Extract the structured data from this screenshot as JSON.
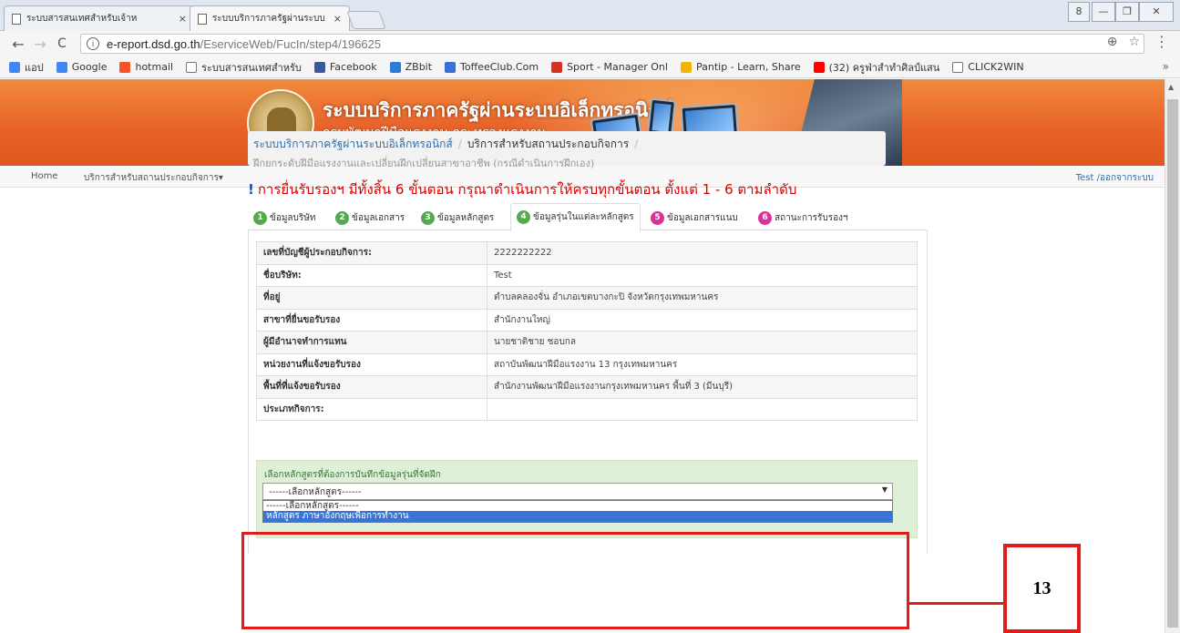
{
  "browser": {
    "tabs": [
      {
        "title": "ระบบสารสนเทศสำหรับเจ้าห",
        "close": "×"
      },
      {
        "title": "ระบบบริการภาครัฐผ่านระบบ",
        "close": "×"
      }
    ],
    "window_controls": [
      "8",
      "—",
      "❐",
      "✕"
    ],
    "url_host": "e-report.dsd.go.th",
    "url_path": "/EserviceWeb/FucIn/step4/196625",
    "bookmarks": [
      {
        "label": "แอป",
        "icon": "apps-grid-icon",
        "color": "#4285f4"
      },
      {
        "label": "Google",
        "icon": "google-icon",
        "color": "#4285f4"
      },
      {
        "label": "hotmail",
        "icon": "microsoft-icon",
        "color": "#f35325"
      },
      {
        "label": "ระบบสารสนเทศสำหรับ",
        "icon": "page-icon",
        "color": "#ffffff"
      },
      {
        "label": "Facebook",
        "icon": "facebook-icon",
        "color": "#3b5998"
      },
      {
        "label": "ZBbit",
        "icon": "zbbit-icon",
        "color": "#2d7bd6"
      },
      {
        "label": "ToffeeClub.Com",
        "icon": "toffee-icon",
        "color": "#3a6fd8"
      },
      {
        "label": "Sport - Manager Onl",
        "icon": "gmail-icon",
        "color": "#d93025"
      },
      {
        "label": "Pantip - Learn, Share",
        "icon": "pantip-icon",
        "color": "#f1b400"
      },
      {
        "label": "(32) ครูฟ่าสำทำศิลป์แสน",
        "icon": "youtube-icon",
        "color": "#ff0000"
      },
      {
        "label": "CLICK2WIN",
        "icon": "page-icon",
        "color": "#ffffff"
      }
    ],
    "bookmarks_more": "»"
  },
  "banner": {
    "title": "ระบบบริการภาครัฐผ่านระบบอิเล็กทรอนิกส์",
    "subtitle": "กรมพัฒนาฝีมือแรงงาน กระทรวงแรงงาน"
  },
  "topnav": {
    "home": "Home",
    "services": "บริการสำหรับสถานประกอบกิจการ",
    "logout": "Test /ออกจากระบบ"
  },
  "breadcrumb": {
    "root": "ระบบบริการภาครัฐผ่านระบบอิเล็กทรอนิกส์",
    "section": "บริการสำหรับสถานประกอบกิจการ",
    "sub": "ฝึกยกระดับฝีมือแรงงานและเปลี่ยนฝึกเปลี่ยนสาขาอาชีพ (กรณีดำเนินการฝึกเอง)"
  },
  "notice": "การยื่นรับรองฯ มีทั้งสิ้น 6 ขั้นตอน กรุณาดำเนินการให้ครบทุกขั้นตอน ตั้งแต่ 1 - 6 ตามลำดับ",
  "steps": [
    {
      "num": "1",
      "label": "ข้อมูลบริษัท"
    },
    {
      "num": "2",
      "label": "ข้อมูลเอกสาร"
    },
    {
      "num": "3",
      "label": "ข้อมูลหลักสูตร"
    },
    {
      "num": "4",
      "label": "ข้อมูลรุ่นในแต่ละหลักสูตร"
    },
    {
      "num": "5",
      "label": "ข้อมูลเอกสารแนบ"
    },
    {
      "num": "6",
      "label": "สถานะการรับรองฯ"
    }
  ],
  "info_rows": [
    {
      "label": "เลขที่บัญชีผู้ประกอบกิจการ:",
      "value": "2222222222"
    },
    {
      "label": "ชื่อบริษัท:",
      "value": "Test"
    },
    {
      "label": "ที่อยู่",
      "value": "ตำบลคลองจั่น อำเภอเขตบางกะปิ จังหวัดกรุงเทพมหานคร"
    },
    {
      "label": "สาขาที่ยื่นขอรับรอง",
      "value": "สำนักงานใหญ่"
    },
    {
      "label": "ผู้มีอำนาจทำการแทน",
      "value": "นายชาติชาย ชอบกล"
    },
    {
      "label": "หน่วยงานที่แจ้งขอรับรอง",
      "value": "สถาบันพัฒนาฝีมือแรงงาน 13 กรุงเทพมหานคร"
    },
    {
      "label": "พื้นที่ที่แจ้งขอรับรอง",
      "value": "สำนักงานพัฒนาฝีมือแรงงานกรุงเทพมหานคร พื้นที่ 3 (มีนบุรี)"
    },
    {
      "label": "ประเภทกิจการ:",
      "value": ""
    }
  ],
  "course": {
    "hint": "เลือกหลักสูตรที่ต้องการบันทึกข้อมูลรุ่นที่จัดฝึก",
    "selected": "------เลือกหลักสูตร------",
    "options": [
      "------เลือกหลักสูตร------",
      "หลักสูตร ภาษาอังกฤษเพื่อการทำงาน"
    ]
  },
  "callout_number": "13",
  "colors": {
    "banner": "#e8632a",
    "notice": "#d80000",
    "highlight": "#e41b1b",
    "step_green": "#55a94e",
    "step_pink": "#d6349b",
    "selected_option": "#3875d7"
  }
}
